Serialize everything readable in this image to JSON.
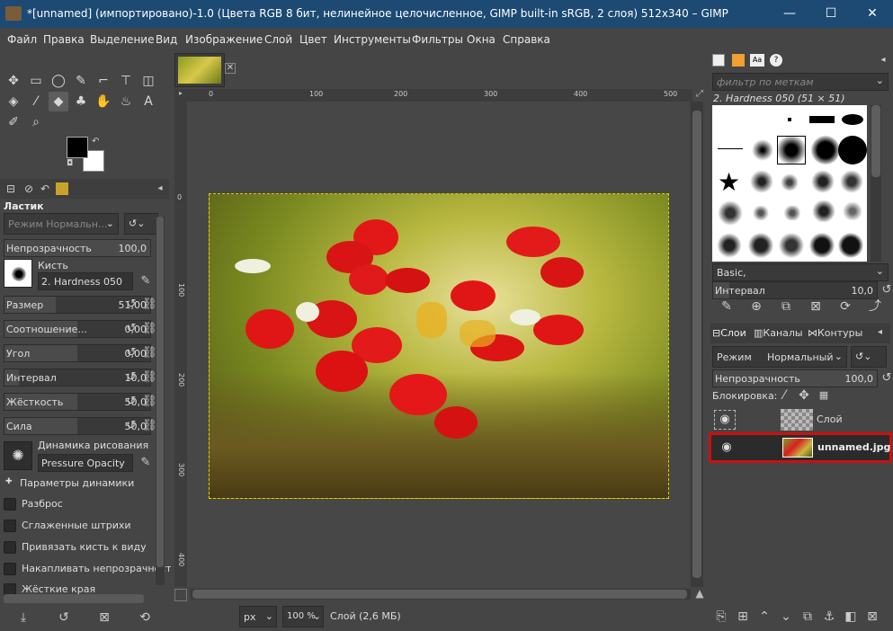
{
  "window": {
    "title": "*[unnamed] (импортировано)-1.0 (Цвета RGB 8 бит, нелинейное целочисленное, GIMP built-in sRGB, 2 слоя) 512x340 – GIMP",
    "min": "—",
    "max": "☐",
    "close": "✕"
  },
  "menu": [
    "Файл",
    "Правка",
    "Выделение",
    "Вид",
    "Изображение",
    "Слой",
    "Цвет",
    "Инструменты",
    "Фильтры",
    "Окна",
    "Справка"
  ],
  "toolopts": {
    "title": "Ластик",
    "mode": "Режим Нормальн...",
    "opacity_label": "Непрозрачность",
    "opacity_value": "100,0",
    "brush_label": "Кисть",
    "brush_value": "2. Hardness 050",
    "sliders": [
      {
        "label": "Размер",
        "value": "51,00",
        "fill": 0.35
      },
      {
        "label": "Соотношение...",
        "value": "0,00",
        "fill": 0.5
      },
      {
        "label": "Угол",
        "value": "0,00",
        "fill": 0.5
      },
      {
        "label": "Интервал",
        "value": "10,0",
        "fill": 0.1
      },
      {
        "label": "Жёсткость",
        "value": "50,0",
        "fill": 0.5
      },
      {
        "label": "Сила",
        "value": "50,0",
        "fill": 0.5
      }
    ],
    "dynamics_label": "Динамика рисования",
    "dynamics_value": "Pressure Opacity",
    "dyn_params": "Параметры динамики",
    "checks": [
      "Разброс",
      "Сглаженные штрихи",
      "Привязать кисть к виду",
      "Накапливать непрозрачность",
      "Жёсткие края"
    ]
  },
  "canvas": {
    "tab_close": "✕",
    "ruler_h": [
      "0",
      "100",
      "200",
      "300",
      "400",
      "500"
    ],
    "ruler_v": [
      "0",
      "100",
      "200",
      "300",
      "400"
    ]
  },
  "status": {
    "unit": "px",
    "zoom": "100 %",
    "info": "Слой (2,6 МБ)"
  },
  "brushes": {
    "filter_placeholder": "фильтр по меткам",
    "selected": "2. Hardness 050 (51 × 51)",
    "preset": "Basic,",
    "interval_label": "Интервал",
    "interval_value": "10,0"
  },
  "layers": {
    "tabs": [
      "Слои",
      "Каналы",
      "Контуры"
    ],
    "mode_label": "Режим",
    "mode_value": "Нормальный",
    "opacity_label": "Непрозрачность",
    "opacity_value": "100,0",
    "lock_label": "Блокировка:",
    "items": [
      {
        "name": "Слой"
      },
      {
        "name": "unnamed.jpg"
      }
    ]
  },
  "colors": {
    "highlight": "#cc1010",
    "selected_row": "#2b2b2b"
  }
}
